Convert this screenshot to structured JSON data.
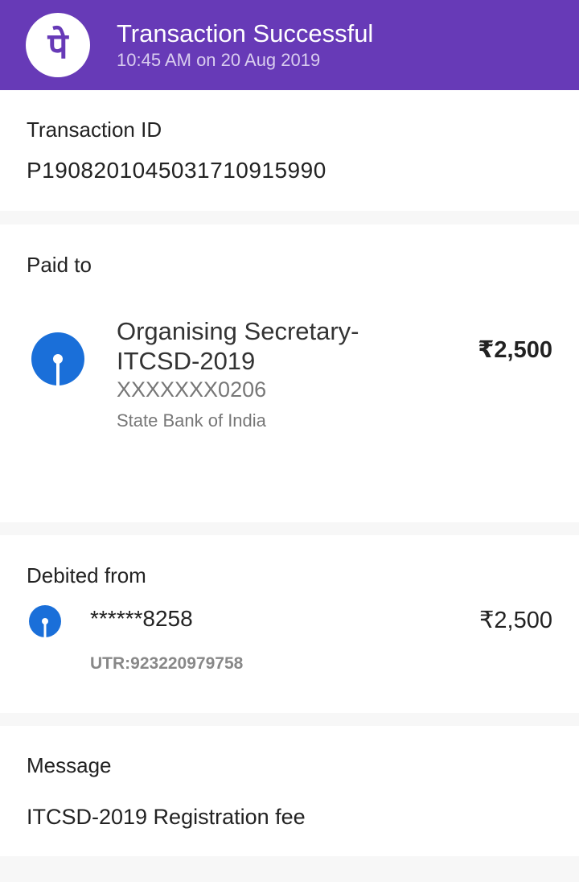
{
  "header": {
    "title": "Transaction Successful",
    "subtitle": "10:45 AM on 20 Aug 2019",
    "logo_icon": "phonepe-logo-icon",
    "brand_color": "#673ab7"
  },
  "transaction": {
    "label": "Transaction ID",
    "id": "P1908201045031710915990"
  },
  "paid_to": {
    "label": "Paid to",
    "name": "Organising Secretary-ITCSD-2019",
    "account": "XXXXXXX0206",
    "bank": "State Bank of India",
    "amount": "₹2,500",
    "bank_icon": "sbi-logo-icon",
    "bank_color": "#1a6fd9"
  },
  "debited_from": {
    "label": "Debited from",
    "account": "******8258",
    "utr": "UTR:923220979758",
    "amount": "₹2,500",
    "bank_icon": "sbi-logo-icon"
  },
  "message": {
    "label": "Message",
    "text": "ITCSD-2019 Registration fee"
  }
}
